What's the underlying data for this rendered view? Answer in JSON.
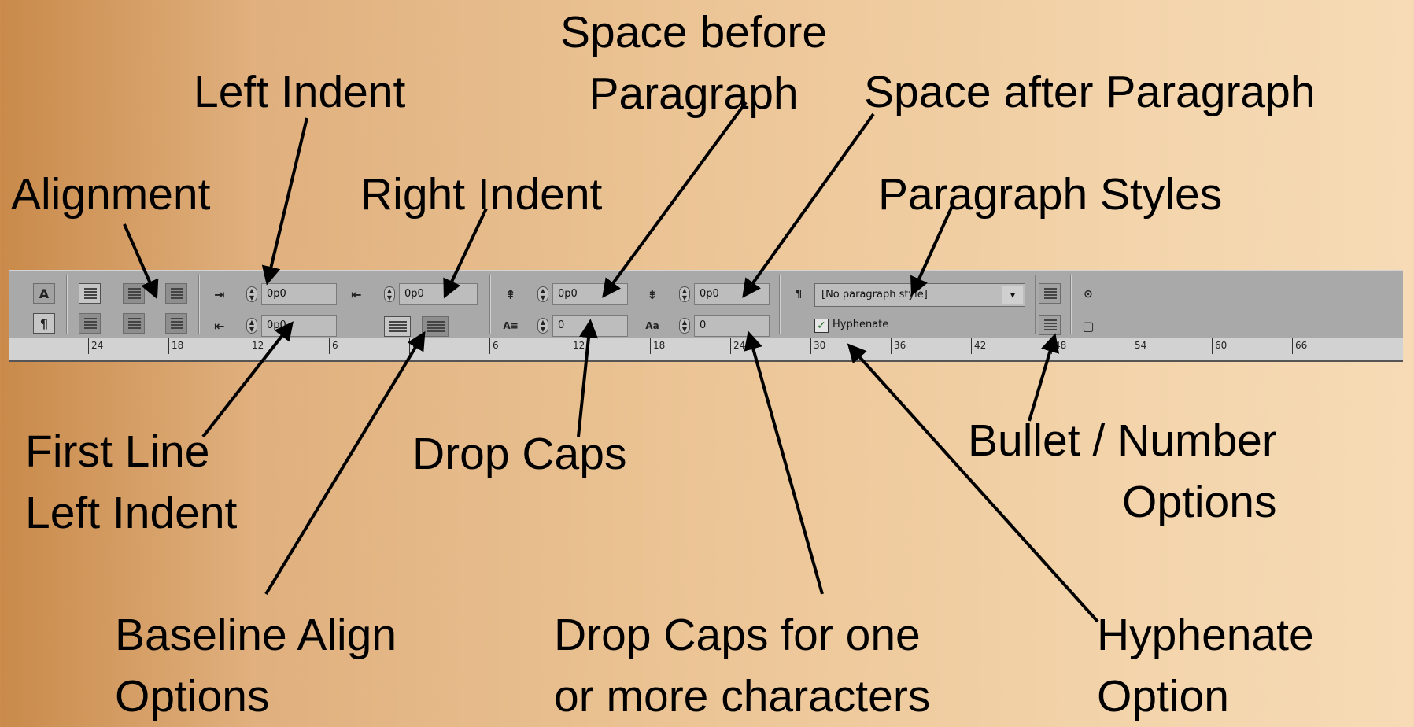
{
  "labels": {
    "space_before_1": "Space  before",
    "space_before_2": "Paragraph",
    "left_indent": "Left Indent",
    "space_after": "Space  after Paragraph",
    "alignment": "Alignment",
    "right_indent": "Right Indent",
    "paragraph_styles": "Paragraph Styles",
    "first_line_1": "First Line",
    "first_line_2": "Left Indent",
    "drop_caps": "Drop Caps",
    "bullet_number_1": "Bullet / Number",
    "bullet_number_2": "Options",
    "baseline_align_1": "Baseline Align",
    "baseline_align_2": "Options",
    "drop_caps_chars_1": "Drop Caps for one",
    "drop_caps_chars_2": "or more characters",
    "hyphenate_option_1": "Hyphenate",
    "hyphenate_option_2": "Option"
  },
  "toolbar": {
    "char_mode_icon": "A",
    "para_mode_icon": "¶",
    "left_indent_value": "0p0",
    "first_line_indent_value": "0p0",
    "right_indent_value": "0p0",
    "space_before_value": "0p0",
    "drop_cap_lines_value": "0",
    "space_after_value": "0p0",
    "drop_cap_chars_value": "0",
    "paragraph_style_value": "[No paragraph style]",
    "hyphenate_label": "Hyphenate",
    "hyphenate_checked": true,
    "para_style_icon": "¶"
  },
  "ruler": {
    "ticks": [
      "24",
      "18",
      "12",
      "6",
      "0",
      "6",
      "12",
      "18",
      "24",
      "30",
      "36",
      "42",
      "48",
      "54",
      "60",
      "66"
    ]
  },
  "icons": {
    "spinner": "spinner-icon",
    "dropdown": "chevron-down-icon",
    "check": "checkmark-icon",
    "panel_menu": "panel-menu-icon",
    "new_doc": "new-document-icon"
  }
}
